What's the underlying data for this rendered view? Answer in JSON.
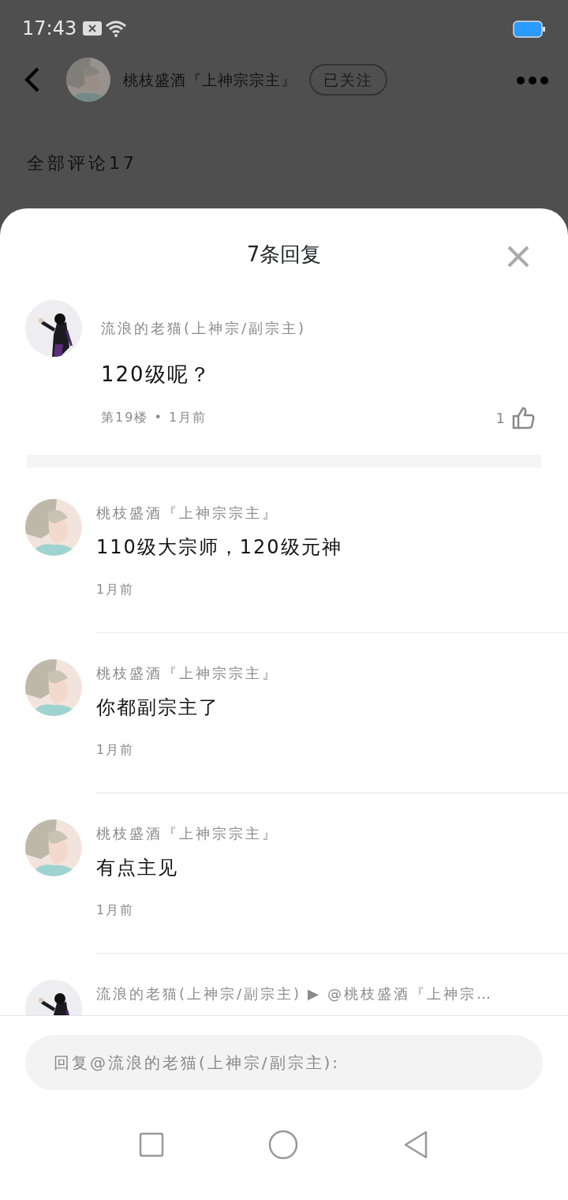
{
  "status_bar": {
    "time": "17:43"
  },
  "header": {
    "author": "桃枝盛酒『上神宗宗主』",
    "follow_button": "已关注"
  },
  "section_title": "全部评论17",
  "sheet": {
    "title": "7条回复",
    "main_comment": {
      "author": "流浪的老猫(上神宗/副宗主)",
      "text": "120级呢？",
      "meta": "第19楼 • 1月前",
      "likes": "1"
    },
    "replies": [
      {
        "kind": "plain",
        "author": "桃枝盛酒『上神宗宗主』",
        "text": "110级大宗师，120级元神",
        "time": "1月前"
      },
      {
        "kind": "plain",
        "author": "桃枝盛酒『上神宗宗主』",
        "text": "你都副宗主了",
        "time": "1月前"
      },
      {
        "kind": "plain",
        "author": "桃枝盛酒『上神宗宗主』",
        "text": "有点主见",
        "time": "1月前"
      },
      {
        "kind": "reply_to",
        "author": "流浪的老猫(上神宗/副宗主)",
        "arrow": "▶",
        "target": "@桃枝盛酒『上神宗…"
      }
    ],
    "input": {
      "placeholder": "回复@流浪的老猫(上神宗/副宗主):"
    }
  }
}
